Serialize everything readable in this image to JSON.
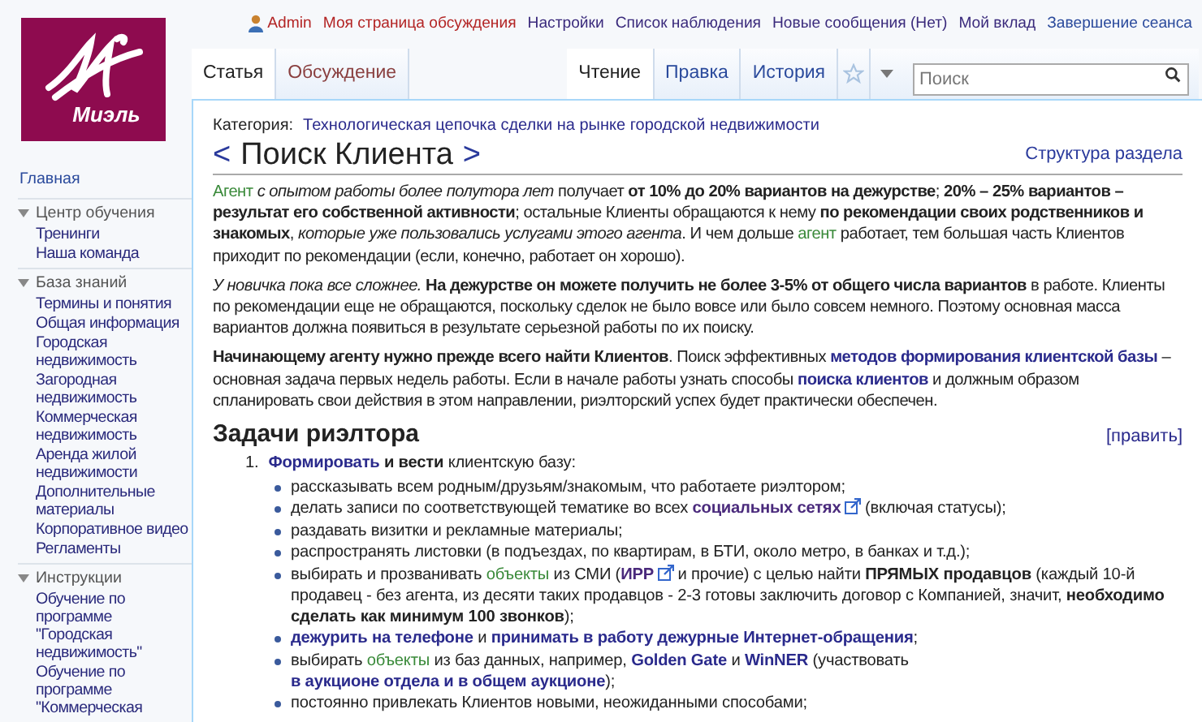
{
  "personal_links": [
    {
      "label": "Admin",
      "kind": "user"
    },
    {
      "label": "Моя страница обсуждения",
      "kind": "redlink"
    },
    {
      "label": "Настройки",
      "kind": "visited"
    },
    {
      "label": "Список наблюдения",
      "kind": "visited"
    },
    {
      "label": "Новые сообщения (Нет)",
      "kind": "visited"
    },
    {
      "label": "Мой вклад",
      "kind": "visited"
    },
    {
      "label": "Завершение сеанса",
      "kind": "link"
    }
  ],
  "logo": {
    "text": "Миэль"
  },
  "left_tabs": [
    {
      "label": "Статья",
      "selected": true
    },
    {
      "label": "Обсуждение",
      "selected": false
    }
  ],
  "right_tabs": [
    {
      "label": "Чтение",
      "selected": true
    },
    {
      "label": "Правка",
      "selected": false
    },
    {
      "label": "История",
      "selected": false
    }
  ],
  "search": {
    "placeholder": "Поиск"
  },
  "sidebar": {
    "main_link": "Главная",
    "sections": [
      {
        "title": "Центр обучения",
        "expanded": true,
        "items": [
          "Тренинги",
          "Наша команда"
        ]
      },
      {
        "title": "База знаний",
        "expanded": true,
        "items": [
          "Термины и понятия",
          "Общая информация",
          "Городская недвижимость",
          "Загородная недвижимость",
          "Коммерческая недвижимость",
          "Аренда жилой недвижимости",
          "Дополнительные материалы",
          "Корпоративное видео",
          "Регламенты"
        ]
      },
      {
        "title": "Инструкции",
        "expanded": true,
        "items": [
          "Обучение по программе \"Городская недвижимость\"",
          "Обучение по программе \"Коммерческая"
        ]
      }
    ]
  },
  "category": {
    "label": "Категория:",
    "value": "Технологическая цепочка сделки на рынке городской недвижимости"
  },
  "title": {
    "prev": "<",
    "text": "Поиск Клиента",
    "next": ">"
  },
  "section_link": "Структура раздела",
  "paragraphs": [
    [
      {
        "kind": "term",
        "text": "Агент"
      },
      {
        "kind": "italic",
        "text": " с опытом работы более полутора лет"
      },
      {
        "kind": "text",
        "text": " получает "
      },
      {
        "kind": "bold",
        "text": "от 10% до 20% вариантов на дежурстве"
      },
      {
        "kind": "text",
        "text": "; "
      },
      {
        "kind": "bold",
        "text": "20% – 25% вариантов – результат его собственной активности"
      },
      {
        "kind": "text",
        "text": "; остальные Клиенты обращаются к нему "
      },
      {
        "kind": "bold",
        "text": "по рекомендации своих родственников и знакомых"
      },
      {
        "kind": "text",
        "text": ", "
      },
      {
        "kind": "italic",
        "text": "которые уже пользовались услугами этого агента"
      },
      {
        "kind": "text",
        "text": ". И чем дольше "
      },
      {
        "kind": "term",
        "text": "агент"
      },
      {
        "kind": "text",
        "text": " работает, тем большая часть Клиентов приходит по рекомендации (если, конечно, работает он хорошо)."
      }
    ],
    [
      {
        "kind": "italic",
        "text": "У новичка пока все сложнее. "
      },
      {
        "kind": "bold",
        "text": "На дежурстве он можете получить не более 3-5% от общего числа вариантов"
      },
      {
        "kind": "text",
        "text": " в работе. Клиенты по рекомендации еще не обращаются, поскольку сделок не было вовсе или было совсем немного. Поэтому основная масса вариантов должна появиться в результате серьезной работы по их поиску."
      }
    ],
    [
      {
        "kind": "bold",
        "text": "Начинающему агенту нужно прежде всего найти Клиентов"
      },
      {
        "kind": "text",
        "text": ". Поиск эффективных "
      },
      {
        "kind": "link",
        "text": "методов формирования клиентской базы"
      },
      {
        "kind": "text",
        "text": " – основная задача первых недель работы. Если в начале работы узнать способы "
      },
      {
        "kind": "link",
        "text": "поиска клиентов"
      },
      {
        "kind": "text",
        "text": " и должным образом спланировать свои действия в этом направлении, риэлторский успех будет практически обеспечен."
      }
    ]
  ],
  "section": {
    "heading": "Задачи риэлтора",
    "edit": "[править]",
    "items": [
      {
        "number": "1.",
        "segments": [
          {
            "kind": "link",
            "text": "Формировать"
          },
          {
            "kind": "bold",
            "text": " и вести"
          },
          {
            "kind": "text",
            "text": " клиентскую базу:"
          }
        ],
        "bullets": [
          [
            {
              "kind": "text",
              "text": "рассказывать всем родным/друзьям/знакомым, что работаете риэлтором;"
            }
          ],
          [
            {
              "kind": "text",
              "text": "делать записи по соответствующей тематике во всех "
            },
            {
              "kind": "extlink",
              "text": "социальных сетях"
            },
            {
              "kind": "text",
              "text": " (включая статусы);"
            }
          ],
          [
            {
              "kind": "text",
              "text": "раздавать визитки и рекламные материалы;"
            }
          ],
          [
            {
              "kind": "text",
              "text": "распространять листовки (в подъездах, по квартирам, в БТИ, около метро, в банках и т.д.);"
            }
          ],
          [
            {
              "kind": "text",
              "text": "выбирать и прозванивать "
            },
            {
              "kind": "term",
              "text": "объекты"
            },
            {
              "kind": "text",
              "text": " из СМИ ("
            },
            {
              "kind": "extlink",
              "text": "ИРР"
            },
            {
              "kind": "text",
              "text": " и прочие) с целью найти "
            },
            {
              "kind": "bold",
              "text": "ПРЯМЫХ продавцов"
            },
            {
              "kind": "text",
              "text": " (каждый 10-й продавец - без агента, из десяти таких продавцов - 2-3 готовы заключить договор с Компанией, значит, "
            },
            {
              "kind": "bold",
              "text": "необходимо сделать как минимум 100 звонков"
            },
            {
              "kind": "text",
              "text": ");"
            }
          ],
          [
            {
              "kind": "link",
              "text": "дежурить на телефоне"
            },
            {
              "kind": "text",
              "text": " и "
            },
            {
              "kind": "link",
              "text": "принимать в работу дежурные Интернет-обращения"
            },
            {
              "kind": "text",
              "text": ";"
            }
          ],
          [
            {
              "kind": "text",
              "text": "выбирать "
            },
            {
              "kind": "term",
              "text": "объекты"
            },
            {
              "kind": "text",
              "text": " из баз данных, например, "
            },
            {
              "kind": "link",
              "text": "Golden Gate"
            },
            {
              "kind": "text",
              "text": " и "
            },
            {
              "kind": "link",
              "text": "WinNER"
            },
            {
              "kind": "text",
              "text": " (участвовать "
            },
            {
              "kind": "link",
              "text": "в аукционе отдела и в общем аукционе"
            },
            {
              "kind": "text",
              "text": ");"
            }
          ],
          [
            {
              "kind": "text",
              "text": "постоянно привлекать Клиентов новыми, неожиданными способами;"
            }
          ]
        ]
      }
    ]
  }
}
